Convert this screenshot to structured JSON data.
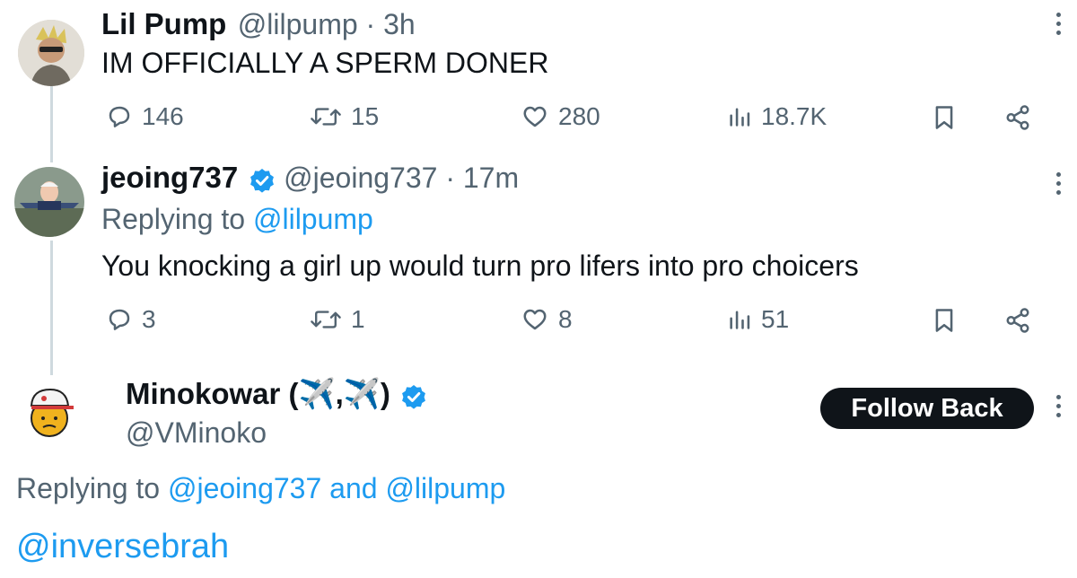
{
  "tweets": [
    {
      "name": "Lil Pump",
      "meta": "@lilpump · 3h",
      "text": "IM OFFICIALLY A SPERM DONER",
      "replies": "146",
      "reposts": "15",
      "likes": "280",
      "views": "18.7K"
    },
    {
      "name": "jeoing737",
      "meta": "@jeoing737 · 17m",
      "replying_prefix": "Replying to",
      "replying_to": "@lilpump",
      "text": "You knocking a girl up would turn pro lifers into pro choicers",
      "replies": "3",
      "reposts": "1",
      "likes": "8",
      "views": "51"
    },
    {
      "name": "Minokowar (✈️,✈️)",
      "handle": "@VMinoko",
      "follow_label": "Follow Back",
      "replying_prefix": "Replying to",
      "replying_to_1": "@jeoing737",
      "replying_and": "and",
      "replying_to_2": "@lilpump",
      "text": "@inversebrah"
    }
  ],
  "colors": {
    "text": "#0f1419",
    "secondary": "#536471",
    "link": "#1d9bf0",
    "verified": "#1d9bf0",
    "button_bg": "#0f1419"
  },
  "icons": [
    "reply-icon",
    "repost-icon",
    "like-icon",
    "views-icon",
    "bookmark-icon",
    "share-icon",
    "more-icon",
    "verified-icon"
  ]
}
